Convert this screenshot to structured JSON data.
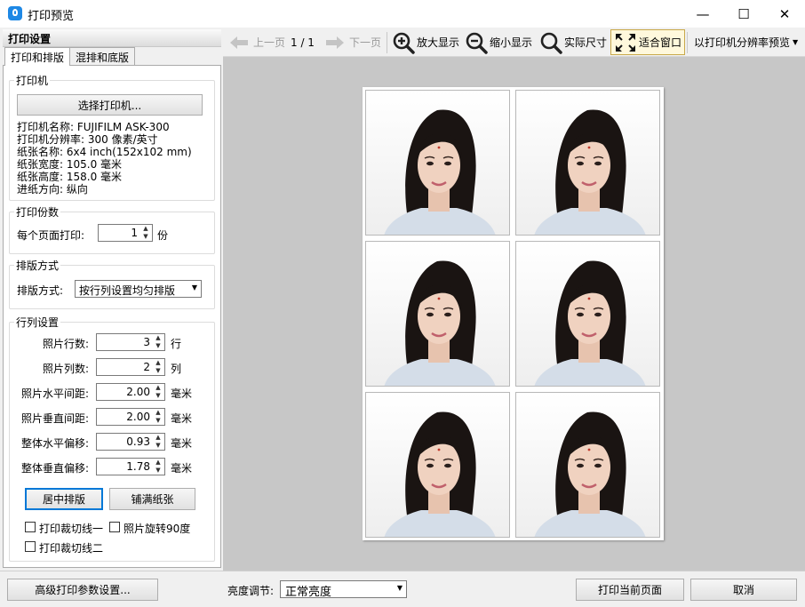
{
  "window": {
    "title": "打印预览",
    "minimize_glyph": "—",
    "maximize_glyph": "☐",
    "close_glyph": "✕"
  },
  "left_panel": {
    "header": "打印设置",
    "tabs": [
      "打印和排版",
      "混排和底版"
    ],
    "printer_group": {
      "title": "打印机",
      "select_button": "选择打印机...",
      "info": [
        "打印机名称:  FUJIFILM ASK-300",
        "打印机分辨率: 300 像素/英寸",
        "纸张名称:  6x4 inch(152x102 mm)",
        "纸张宽度:  105.0 毫米",
        "纸张高度:  158.0 毫米",
        "进纸方向:  纵向"
      ]
    },
    "copies_group": {
      "title": "打印份数",
      "label": "每个页面打印:",
      "value": "1",
      "unit": "份"
    },
    "layout_group": {
      "title": "排版方式",
      "label": "排版方式:",
      "selected": "按行列设置均匀排版"
    },
    "grid_group": {
      "title": "行列设置",
      "rows": [
        {
          "label": "照片行数:",
          "value": "3",
          "unit": "行"
        },
        {
          "label": "照片列数:",
          "value": "2",
          "unit": "列"
        },
        {
          "label": "照片水平间距:",
          "value": "2.00",
          "unit": "毫米"
        },
        {
          "label": "照片垂直间距:",
          "value": "2.00",
          "unit": "毫米"
        },
        {
          "label": "整体水平偏移:",
          "value": "0.93",
          "unit": "毫米"
        },
        {
          "label": "整体垂直偏移:",
          "value": "1.78",
          "unit": "毫米"
        }
      ],
      "center_button": "居中排版",
      "fill_button": "铺满纸张",
      "checkboxes": [
        {
          "label": "打印裁切线一",
          "checked": false
        },
        {
          "label": "照片旋转90度",
          "checked": false
        },
        {
          "label": "打印裁切线二",
          "checked": false
        }
      ]
    }
  },
  "toolbar": {
    "prev_page": "上一页",
    "page_indicator": "1 / 1",
    "next_page": "下一页",
    "zoom_in": "放大显示",
    "zoom_out": "缩小显示",
    "actual_size": "实际尺寸",
    "fit_window": "适合窗口",
    "resolution_preview": "以打印机分辨率预览"
  },
  "preview": {
    "photo_count": 6,
    "photo_rows": 3,
    "photo_cols": 2
  },
  "bottom": {
    "advanced_button": "高级打印参数设置...",
    "brightness_label": "亮度调节:",
    "brightness_value": "正常亮度",
    "print_button": "打印当前页面",
    "cancel_button": "取消"
  },
  "colors": {
    "accent": "#0078d7",
    "app_icon": "#1e88e5",
    "preview_bg": "#c7c7c7"
  }
}
